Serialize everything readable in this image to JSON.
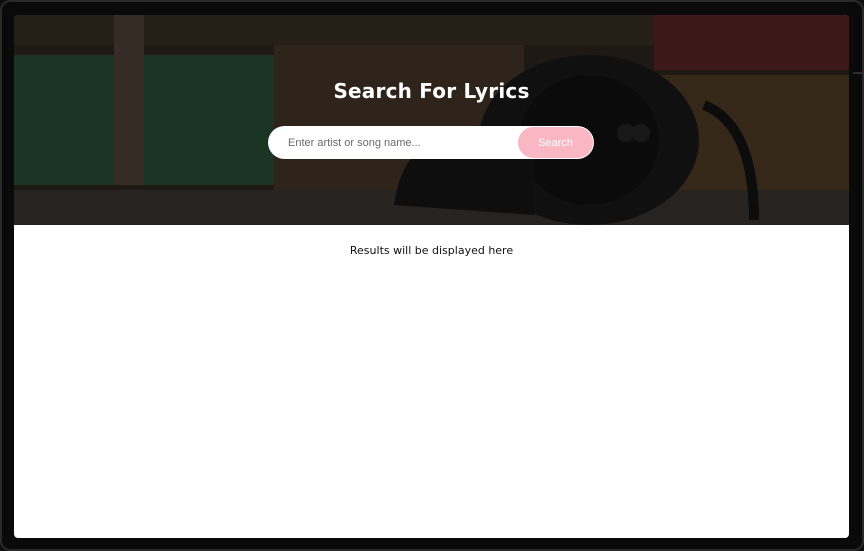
{
  "hero": {
    "title": "Search For Lyrics"
  },
  "search": {
    "placeholder": "Enter artist or song name...",
    "value": "",
    "button_label": "Search"
  },
  "results": {
    "message": "Results will be displayed here"
  },
  "colors": {
    "button_accent": "#f9b6c3",
    "hero_overlay": "#0a0a0a",
    "page_background": "#ffffff"
  },
  "icons": {
    "hero_image": "headphones-photo"
  }
}
